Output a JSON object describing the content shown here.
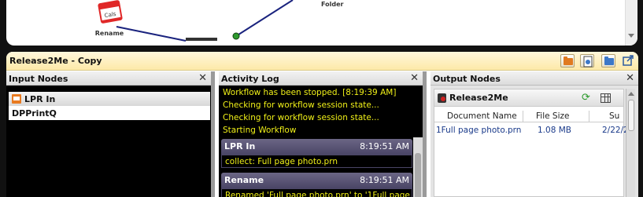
{
  "canvas": {
    "rename_node_label": "Rename",
    "folder_node_label": "Folder",
    "node_icon_text": "Cals"
  },
  "panel": {
    "title": "Release2Me - Copy",
    "toolbar_icons": [
      "folder-orange-icon",
      "gear-document-icon",
      "folder-blue-icon",
      "popout-icon"
    ]
  },
  "input_nodes": {
    "header": "Input Nodes",
    "close": "✕",
    "items": [
      {
        "label": "LPR In",
        "icon": "printer-icon"
      },
      {
        "label": "DPPrintQ"
      }
    ]
  },
  "activity_log": {
    "header": "Activity Log",
    "close": "✕",
    "lines": [
      "Workflow has been stopped. [8:19:39 AM]",
      "Checking for workflow session state...",
      "Checking for workflow session state...",
      "Starting Workflow"
    ],
    "entries": [
      {
        "node": "LPR In",
        "time": "8:19:51 AM",
        "message": "collect: Full page photo.prn"
      },
      {
        "node": "Rename",
        "time": "8:19:51 AM",
        "message": "Renamed 'Full page photo.prn' to '1Full page"
      }
    ]
  },
  "output_nodes": {
    "header": "Output Nodes",
    "close": "✕",
    "card_title": "Release2Me",
    "columns": [
      "Document Name",
      "File Size",
      "Su"
    ],
    "rows": [
      {
        "name": "1Full page photo.prn",
        "size": "1.08 MB",
        "date": "2/22/2"
      }
    ]
  },
  "colors": {
    "title_bar": "#fde9a8",
    "log_text": "#f0f018",
    "entry_header": "#5a5575",
    "connector": "#1a237e",
    "node_dot": "#2e9a2e"
  }
}
